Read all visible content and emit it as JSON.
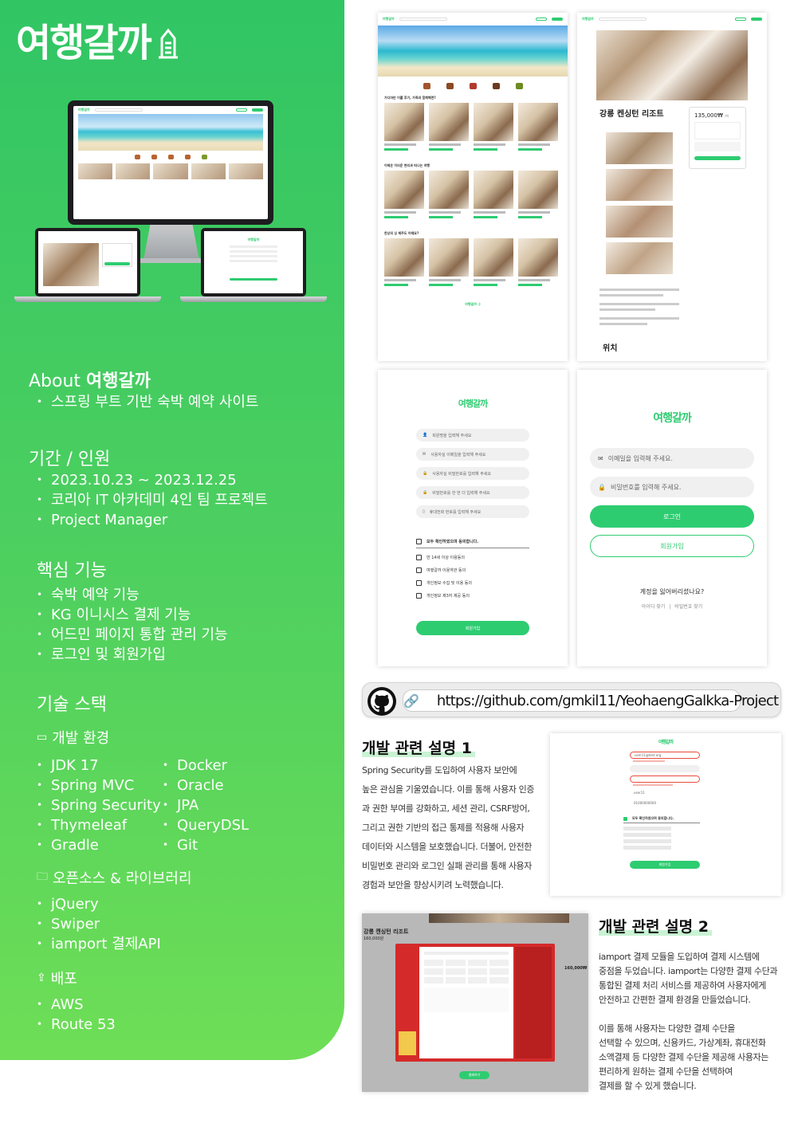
{
  "brand": {
    "name": "여행갈까"
  },
  "about": {
    "title_prefix": "About",
    "brand": "여행갈까",
    "items": [
      "스프링 부트 기반 숙박 예약 사이트"
    ]
  },
  "period": {
    "title": "기간 / 인원",
    "items": [
      "2023.10.23 ~ 2023.12.25",
      "코리아 IT 아카데미 4인  팀 프로젝트",
      "Project Manager"
    ]
  },
  "features": {
    "title": "핵심 기능",
    "items": [
      "숙박 예약 기능",
      "KG 이니시스 결제 기능",
      "어드민 페이지 통합 관리 기능",
      "로그인 및 회원가입"
    ]
  },
  "stack": {
    "title": "기술 스택",
    "dev_env": {
      "title": "개발 환경",
      "col1": [
        "JDK 17",
        "Spring MVC",
        "Spring Security",
        "Thymeleaf",
        "Gradle"
      ],
      "col2": [
        "Docker",
        "Oracle",
        "JPA",
        "QueryDSL",
        "Git"
      ]
    },
    "oss": {
      "title": "오픈소스 & 라이브러리",
      "items": [
        "jQuery",
        "Swiper",
        "iamport 결제API"
      ]
    },
    "deploy": {
      "title": "배포",
      "items": [
        "AWS",
        "Route 53"
      ]
    }
  },
  "screens": {
    "main": {
      "sections": [
        "가디마만 이를 후기, 가족과 함께해면?",
        "이제은 이리운 변리과 떠나는 여행",
        "한상의 싱 제주도 어때요?"
      ],
      "footer": "여행갈까 :)"
    },
    "detail": {
      "title": "강릉 켄싱턴 리조트",
      "price": "135,000₩",
      "price_unit": "/박",
      "location": "위치"
    },
    "signup": {
      "logo": "여행갈까",
      "fields": [
        "회원명을 입력해 주세요",
        "사용자실 이메일을 입력해 주세요",
        "사용자실 비밀번호를 입력해 주세요",
        "비밀번호를 한 번 더 입력해 주세요",
        "휴대전화 번호를 입력해 주세요"
      ],
      "agree_all": "모두 확인하였으며 동의합니다.",
      "agrees": [
        "만 14세 이상 이용동의",
        "여행갈까 이용약관 동의",
        "개인정보 수집 및 이용 동의",
        "개인정보 제3자 제공 동의"
      ],
      "submit": "회원가입"
    },
    "login": {
      "logo": "여행갈까",
      "email_placeholder": "이메일을 입력해 주세요.",
      "password_placeholder": "비밀번호를 입력해 주세요.",
      "login_button": "로그인",
      "signup_button": "회원가입",
      "forgot": "계정을 잃어버리셨나요?",
      "find_id": "아이디 찾기",
      "find_pw": "비밀번호 찾기"
    }
  },
  "github": {
    "url": "https://github.com/gmkil11/YeohaengGalkka-Project"
  },
  "desc1": {
    "title": "개발 관련 설명 1",
    "lines": [
      "Spring Security를 도입하여 사용자 보안에",
      "높은 관심을 기울였습니다. 이를 통해 사용자 인증",
      "과 권한 부여를 강화하고, 세션 관리, CSRF방어,",
      "그리고 권한 기반의 접근 통제를 적용해 사용자",
      "데이터와 시스템을 보호했습니다. 더불어, 안전한",
      "비밀번호 관리와 로그인 실패 관리를 통해 사용자",
      "경험과 보안을 향상시키려 노력했습니다."
    ]
  },
  "validation_screen": {
    "logo": "여행갈까",
    "email_value": "user11@test.org",
    "name_value": "user11",
    "phone_value": "01000000000",
    "agree_all": "모두 확인하였으며 동의합니다.",
    "submit": "회원가입"
  },
  "payment_screen": {
    "title": "강릉 켄싱턴 리조트",
    "price": "160,000원",
    "price_right": "160,000₩",
    "button": "결제하기"
  },
  "desc2": {
    "title": "개발 관련 설명 2",
    "para1": [
      "iamport 결제 모듈을 도입하여 결제 시스템에",
      "중점을 두었습니다. iamport는 다양한 결제 수단과",
      "통합된 결제 처리 서비스를 제공하여 사용자에게",
      "안전하고 간편한 결제 환경을 만들었습니다."
    ],
    "para2": [
      "이를 통해 사용자는 다양한 결제 수단을",
      "선택할 수 있으며, 신용카드, 가상계좌, 휴대전화",
      "소액결제 등 다양한 결제 수단을 제공해 사용자는",
      "편리하게 원하는 결제 수단을 선택하여",
      "결제를 할 수 있게 했습니다."
    ]
  }
}
